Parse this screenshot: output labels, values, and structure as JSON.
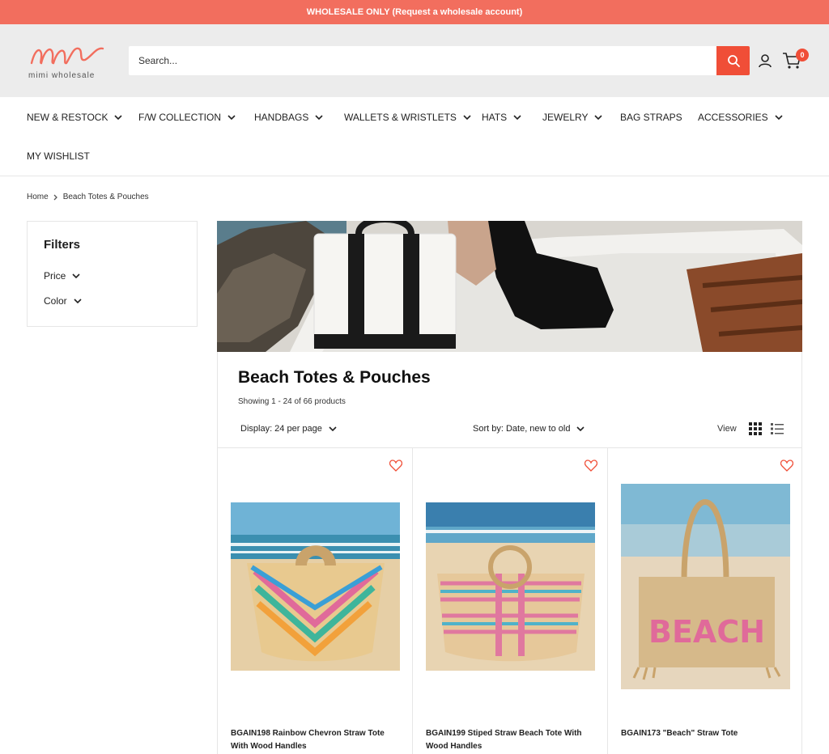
{
  "announcement": "WHOLESALE ONLY (Request a wholesale account)",
  "brand": {
    "logo_text": "mimi wholesale"
  },
  "header": {
    "search_placeholder": "Search...",
    "cart_count": "0"
  },
  "nav": {
    "items": [
      {
        "label": "NEW & RESTOCK",
        "has_dropdown": true
      },
      {
        "label": "F/W COLLECTION",
        "has_dropdown": true
      },
      {
        "label": "HANDBAGS",
        "has_dropdown": true
      },
      {
        "label": "WALLETS & WRISTLETS",
        "has_dropdown": true
      },
      {
        "label": "HATS",
        "has_dropdown": true
      },
      {
        "label": "JEWELRY",
        "has_dropdown": true
      },
      {
        "label": "BAG STRAPS",
        "has_dropdown": false
      },
      {
        "label": "ACCESSORIES",
        "has_dropdown": true
      },
      {
        "label": "MY WISHLIST",
        "has_dropdown": false
      }
    ]
  },
  "breadcrumb": {
    "home": "Home",
    "current": "Beach Totes & Pouches"
  },
  "filters": {
    "title": "Filters",
    "items": [
      "Price",
      "Color"
    ]
  },
  "collection": {
    "title": "Beach Totes & Pouches",
    "count": "Showing 1 - 24 of 66 products",
    "display": "Display: 24 per page",
    "sort": "Sort by: Date, new to old",
    "view_label": "View"
  },
  "products": [
    {
      "name": "BGAIN198 Rainbow Chevron Straw Tote With Wood Handles"
    },
    {
      "name": "BGAIN199 Stiped Straw Beach Tote With Wood Handles"
    },
    {
      "name": "BGAIN173 \"Beach\" Straw Tote"
    }
  ],
  "colors": {
    "accent": "#f04e37",
    "announcement_bg": "#f26e5e",
    "header_bg": "#ececec"
  },
  "icons": [
    "search-icon",
    "account-icon",
    "cart-icon",
    "chevron-down-icon",
    "chevron-right-icon",
    "heart-icon",
    "grid-view-icon",
    "list-view-icon"
  ]
}
